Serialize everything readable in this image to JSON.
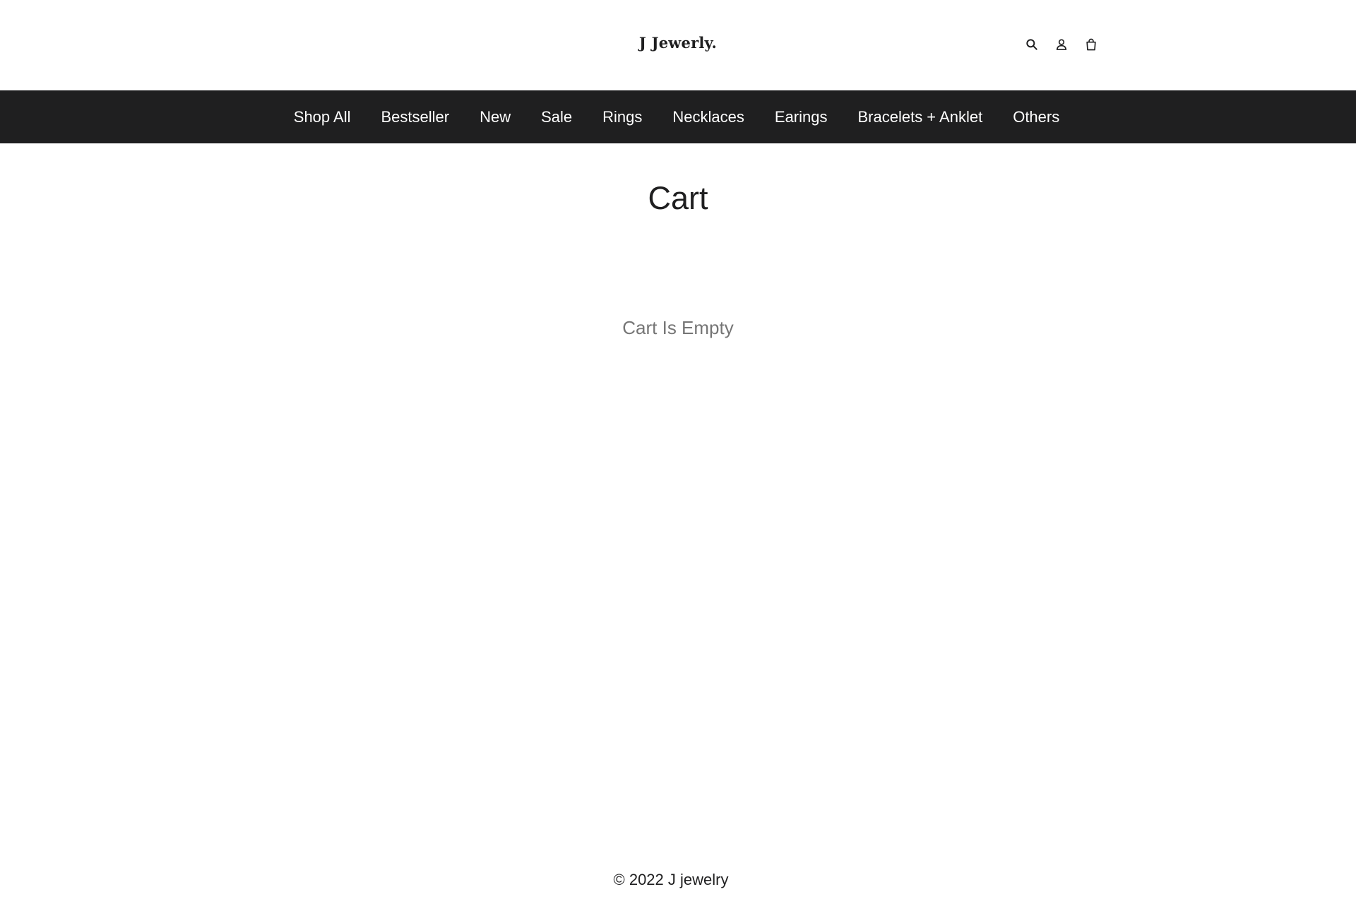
{
  "header": {
    "logo": "J Jewerly.",
    "icons": [
      "search-icon",
      "account-icon",
      "cart-bag-icon"
    ]
  },
  "nav": {
    "items": [
      {
        "label": "Shop All"
      },
      {
        "label": "Bestseller"
      },
      {
        "label": "New"
      },
      {
        "label": "Sale"
      },
      {
        "label": "Rings"
      },
      {
        "label": "Necklaces"
      },
      {
        "label": "Earings"
      },
      {
        "label": "Bracelets + Anklet"
      },
      {
        "label": "Others"
      }
    ]
  },
  "main": {
    "title": "Cart",
    "empty_message": "Cart Is Empty"
  },
  "footer": {
    "copyright": "© 2022 J jewelry"
  },
  "colors": {
    "nav_background": "#1f1f20",
    "text": "#1f1f20",
    "muted_text": "#757575",
    "background": "#ffffff"
  }
}
